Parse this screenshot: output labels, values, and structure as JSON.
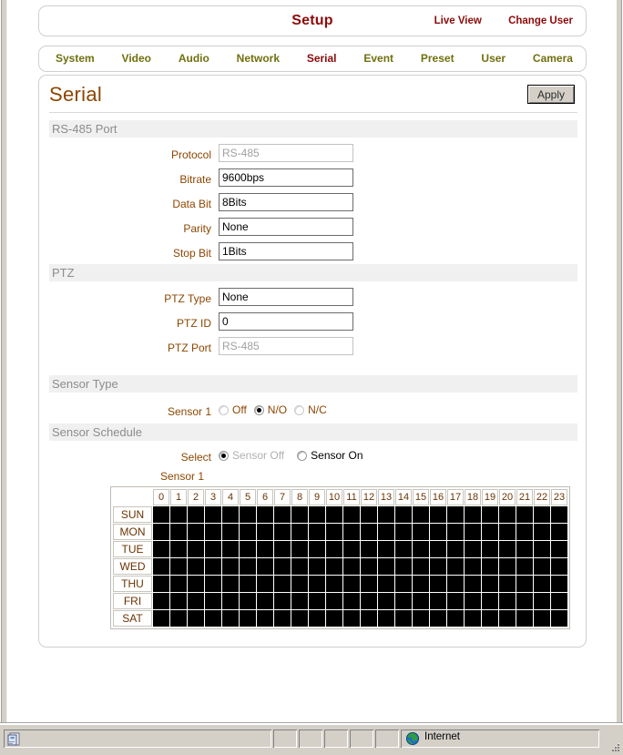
{
  "header": {
    "title": "Setup",
    "links": [
      {
        "label": "Live View",
        "name": "live-view-link"
      },
      {
        "label": "Change User",
        "name": "change-user-link"
      }
    ]
  },
  "tabs": [
    {
      "label": "System",
      "active": false
    },
    {
      "label": "Video",
      "active": false
    },
    {
      "label": "Audio",
      "active": false
    },
    {
      "label": "Network",
      "active": false
    },
    {
      "label": "Serial",
      "active": true
    },
    {
      "label": "Event",
      "active": false
    },
    {
      "label": "Preset",
      "active": false
    },
    {
      "label": "User",
      "active": false
    },
    {
      "label": "Camera",
      "active": false
    }
  ],
  "page": {
    "title": "Serial",
    "apply_label": "Apply"
  },
  "sections": {
    "rs485": {
      "header": "RS-485 Port",
      "fields": [
        {
          "label": "Protocol",
          "value": "RS-485",
          "type": "select",
          "disabled": true
        },
        {
          "label": "Bitrate",
          "value": "9600bps",
          "type": "select",
          "disabled": false
        },
        {
          "label": "Data Bit",
          "value": "8Bits",
          "type": "select",
          "disabled": false
        },
        {
          "label": "Parity",
          "value": "None",
          "type": "select",
          "disabled": false
        },
        {
          "label": "Stop Bit",
          "value": "1Bits",
          "type": "select",
          "disabled": false
        }
      ]
    },
    "ptz": {
      "header": "PTZ",
      "fields": [
        {
          "label": "PTZ Type",
          "value": "None",
          "type": "select",
          "disabled": false
        },
        {
          "label": "PTZ ID",
          "value": "0",
          "type": "text",
          "disabled": false
        },
        {
          "label": "PTZ Port",
          "value": "RS-485",
          "type": "select",
          "disabled": true
        }
      ]
    },
    "sensor_type": {
      "header": "Sensor Type",
      "row_label": "Sensor 1",
      "options": [
        {
          "label": "Off",
          "selected": false,
          "dim_label": false
        },
        {
          "label": "N/O",
          "selected": true,
          "dim_label": false
        },
        {
          "label": "N/C",
          "selected": false,
          "dim_label": false
        }
      ]
    },
    "sensor_schedule": {
      "header": "Sensor Schedule",
      "select_label": "Select",
      "options": [
        {
          "label": "Sensor Off",
          "selected": true,
          "dim_label": true
        },
        {
          "label": "Sensor On",
          "selected": false,
          "dim_label": false
        }
      ],
      "sensor_name": "Sensor 1"
    }
  },
  "schedule_grid": {
    "hours": [
      "0",
      "1",
      "2",
      "3",
      "4",
      "5",
      "6",
      "7",
      "8",
      "9",
      "10",
      "11",
      "12",
      "13",
      "14",
      "15",
      "16",
      "17",
      "18",
      "19",
      "20",
      "21",
      "22",
      "23"
    ],
    "days": [
      "SUN",
      "MON",
      "TUE",
      "WED",
      "THU",
      "FRI",
      "SAT"
    ],
    "filled_color": "#000000",
    "values": [
      [
        1,
        1,
        1,
        1,
        1,
        1,
        1,
        1,
        1,
        1,
        1,
        1,
        1,
        1,
        1,
        1,
        1,
        1,
        1,
        1,
        1,
        1,
        1,
        1
      ],
      [
        1,
        1,
        1,
        1,
        1,
        1,
        1,
        1,
        1,
        1,
        1,
        1,
        1,
        1,
        1,
        1,
        1,
        1,
        1,
        1,
        1,
        1,
        1,
        1
      ],
      [
        1,
        1,
        1,
        1,
        1,
        1,
        1,
        1,
        1,
        1,
        1,
        1,
        1,
        1,
        1,
        1,
        1,
        1,
        1,
        1,
        1,
        1,
        1,
        1
      ],
      [
        1,
        1,
        1,
        1,
        1,
        1,
        1,
        1,
        1,
        1,
        1,
        1,
        1,
        1,
        1,
        1,
        1,
        1,
        1,
        1,
        1,
        1,
        1,
        1
      ],
      [
        1,
        1,
        1,
        1,
        1,
        1,
        1,
        1,
        1,
        1,
        1,
        1,
        1,
        1,
        1,
        1,
        1,
        1,
        1,
        1,
        1,
        1,
        1,
        1
      ],
      [
        1,
        1,
        1,
        1,
        1,
        1,
        1,
        1,
        1,
        1,
        1,
        1,
        1,
        1,
        1,
        1,
        1,
        1,
        1,
        1,
        1,
        1,
        1,
        1
      ],
      [
        1,
        1,
        1,
        1,
        1,
        1,
        1,
        1,
        1,
        1,
        1,
        1,
        1,
        1,
        1,
        1,
        1,
        1,
        1,
        1,
        1,
        1,
        1,
        1
      ]
    ]
  },
  "statusbar": {
    "message": "",
    "zone": "Internet",
    "doc_icon": "page-icon",
    "zone_icon": "globe-icon"
  },
  "colors": {
    "brand_red": "#8b0a0a",
    "tab_olive": "#70700f",
    "label_brown": "#8c4600",
    "section_gray": "#8c8c8c",
    "section_bg": "#f0f0f0",
    "chrome": "#d4d0c8"
  }
}
